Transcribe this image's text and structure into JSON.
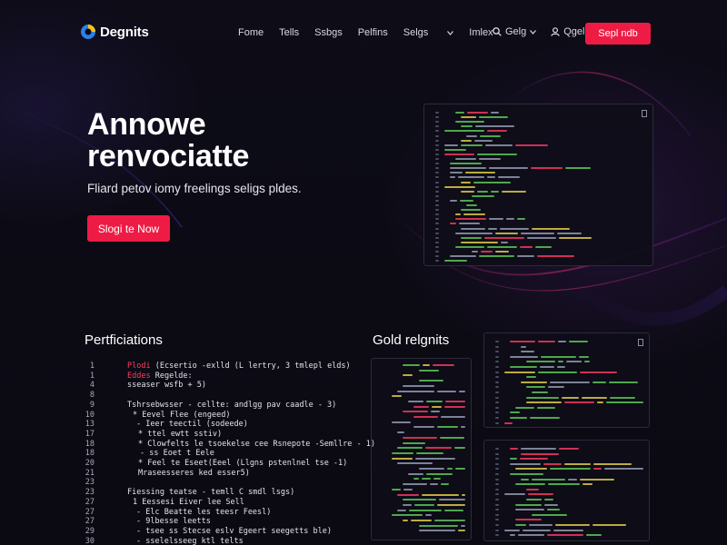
{
  "nav": {
    "brand": "Degnits",
    "links": [
      {
        "label": "Fome",
        "caret": false
      },
      {
        "label": "Tells",
        "caret": false
      },
      {
        "label": "Ssbgs",
        "caret": false
      },
      {
        "label": "Pelfins",
        "caret": false
      },
      {
        "label": "Selgs",
        "caret": true
      },
      {
        "label": "Imlex",
        "caret": false
      }
    ],
    "search_label": "Gelg",
    "signin_label": "Qgelg",
    "cta_label": "Sepl ndb"
  },
  "hero": {
    "title_line1": "Annowe",
    "title_line2": "renvociatte",
    "subtitle": "Fliard petov iomy freelings seligs pldes.",
    "cta_label": "Slogi te Now"
  },
  "sections": {
    "left_title": "Pertficiations",
    "right_title": "Gold relgnits"
  },
  "code_listing": [
    {
      "num": "1",
      "kw": "Plodi",
      "text": "(Ecsertio -exlld (L lertry, 3 tmlepl elds)"
    },
    {
      "num": "1",
      "kw": "Eddes",
      "text": "Regelde:"
    },
    {
      "num": "4",
      "kw": "",
      "text": "sseaser wsfb + 5)"
    },
    {
      "num": "8",
      "kw": "",
      "text": ""
    },
    {
      "num": "9",
      "kw": "",
      "text": "Tshrsebwsser - cellte: andlgg pav caadle - 3)"
    },
    {
      "num": "10",
      "kw": "",
      "text": "* Eevel Flee (engeed)"
    },
    {
      "num": "13",
      "kw": "",
      "text": "- Ieer teectil (sodeede)"
    },
    {
      "num": "17",
      "kw": "",
      "text": "* ttel ewtt sstiv)"
    },
    {
      "num": "18",
      "kw": "",
      "text": "* Clowfelts le tsoekelse cee Rsnepote -Semllre - 1)"
    },
    {
      "num": "18",
      "kw": "",
      "text": "- ss Eoet t Eele"
    },
    {
      "num": "20",
      "kw": "",
      "text": "* Feel te Eseet(Eeel (Llgns pstenlnel tse -1)"
    },
    {
      "num": "21",
      "kw": "",
      "text": "Mraseesseres ked esser5)"
    },
    {
      "num": "23",
      "kw": "",
      "text": ""
    },
    {
      "num": "23",
      "kw": "",
      "text": "Fiessing teatse - temll C smdl lsgs)"
    },
    {
      "num": "27",
      "kw": "",
      "text": "1 Eessesi Eiver lee Sell"
    },
    {
      "num": "27",
      "kw": "",
      "text": "- Elc Beatte les teesr Feesl)"
    },
    {
      "num": "27",
      "kw": "",
      "text": "- 9lbesse leetts"
    },
    {
      "num": "29",
      "kw": "",
      "text": "- tsee ss Stecse eslv Egeert seegetts ble)"
    },
    {
      "num": "30",
      "kw": "",
      "text": "- sselelsseeg ktl telts"
    }
  ],
  "colors": {
    "accent": "#ee1c44",
    "background": "#0c0b14",
    "panel_border": "#2c2b3c",
    "code_keyword": "#ff3b63",
    "code_green": "#5fcf5a",
    "code_yellow": "#e8d44a"
  },
  "icons": {
    "brand": "logo-mark",
    "search": "search-icon",
    "signin": "user-icon",
    "caret": "chevron-down-icon",
    "panel": "document-icon"
  }
}
